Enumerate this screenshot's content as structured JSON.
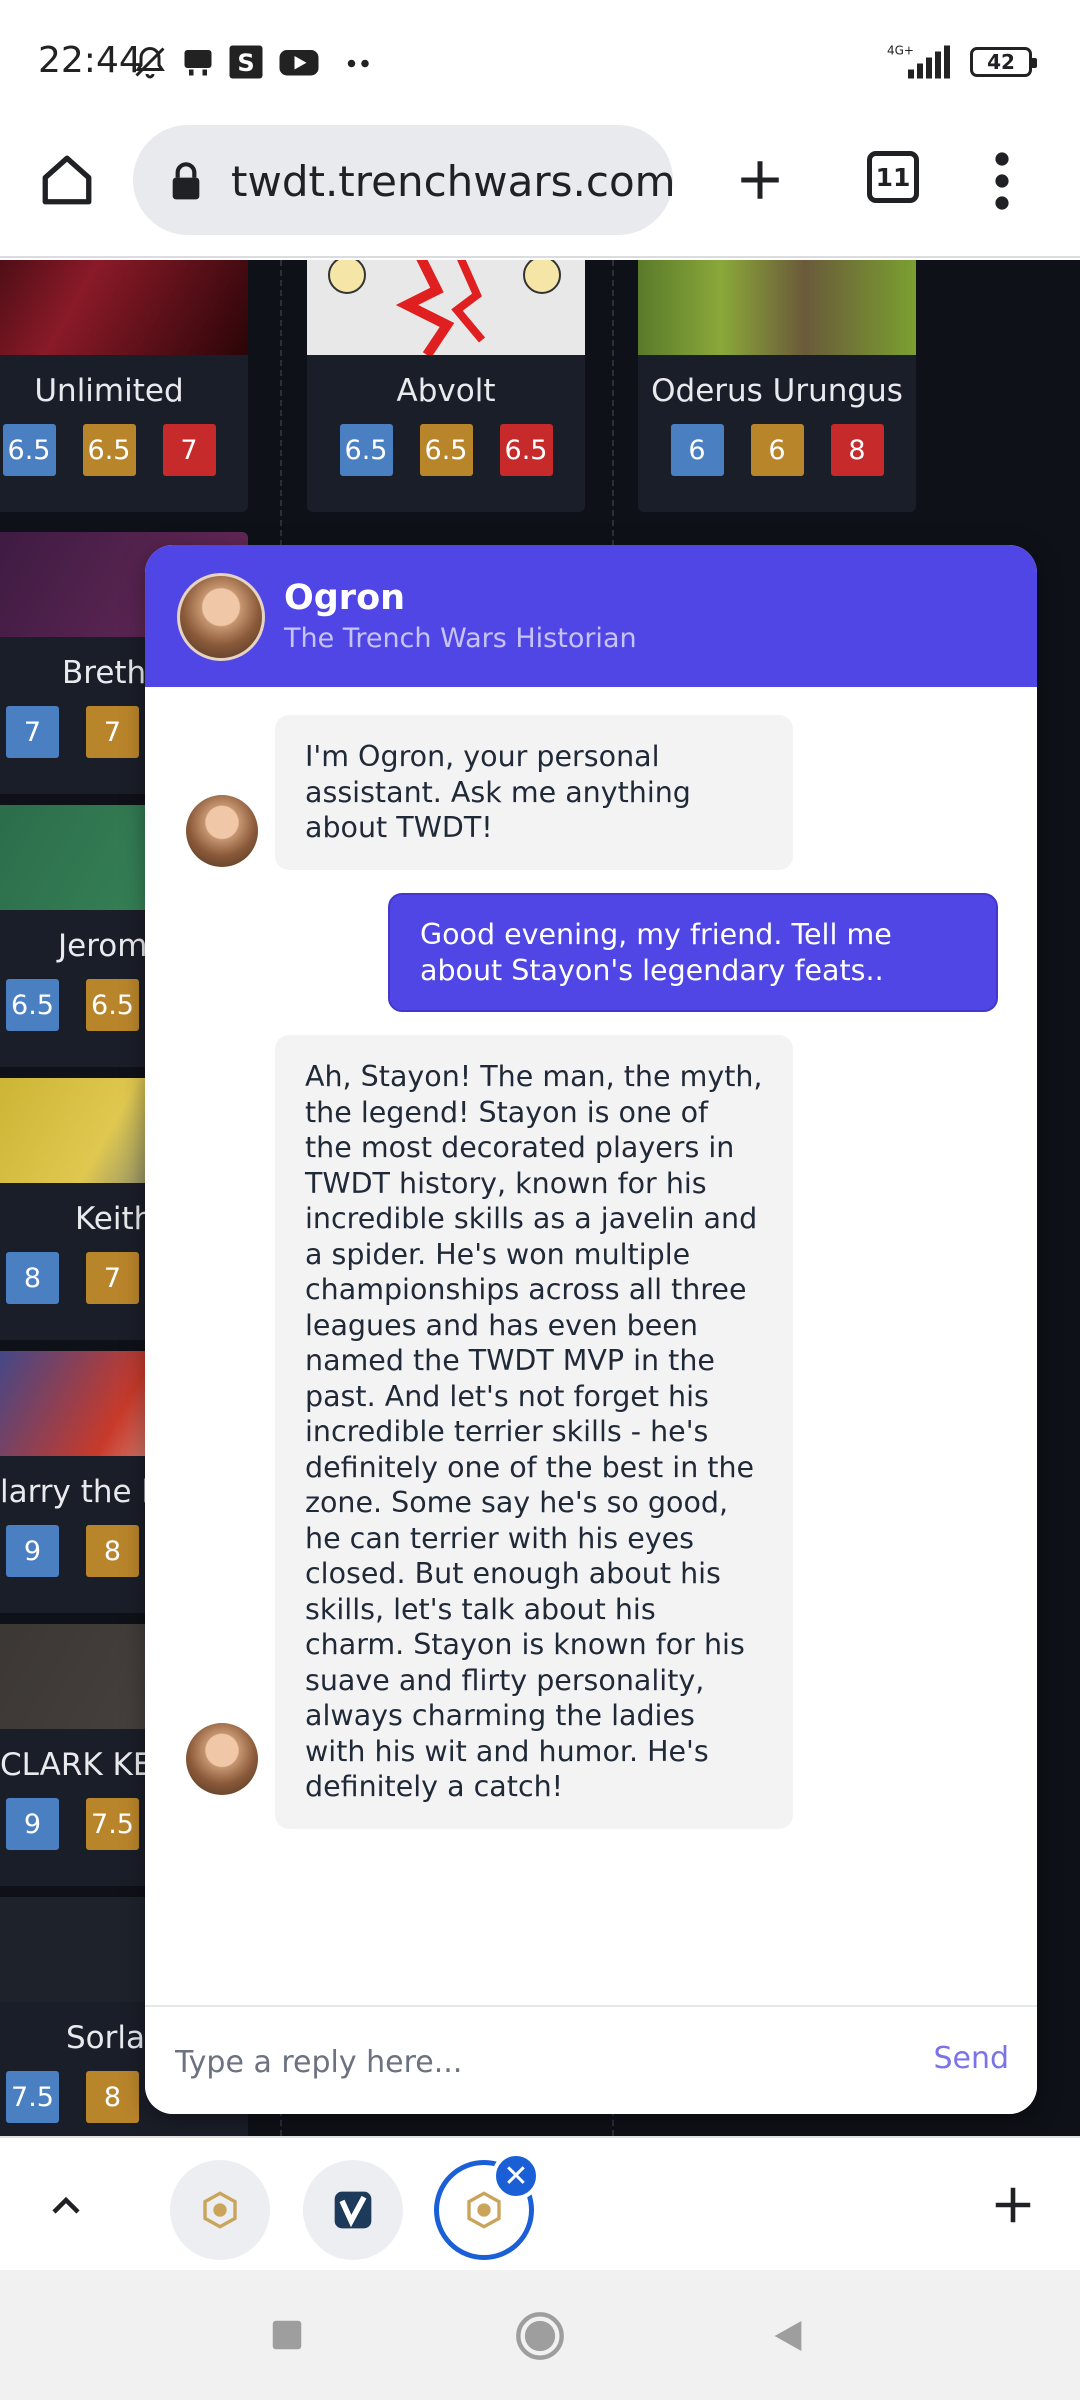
{
  "status_bar": {
    "time": "22:44",
    "network": "4G+",
    "battery": "42"
  },
  "browser": {
    "url": "twdt.trenchwars.com",
    "tab_count": "11"
  },
  "cards": [
    {
      "name": "Unlimited",
      "ratings": [
        "6.5",
        "6.5",
        "7"
      ]
    },
    {
      "name": "Abvolt",
      "ratings": [
        "6.5",
        "6.5",
        "6.5"
      ]
    },
    {
      "name": "Oderus Urungus",
      "ratings": [
        "6",
        "6",
        "8"
      ]
    },
    {
      "name": "Bretha",
      "ratings": [
        "7",
        "7"
      ]
    },
    {
      "name": "Jerom",
      "ratings": [
        "6.5",
        "6.5"
      ]
    },
    {
      "name": "Keith",
      "ratings": [
        "8",
        "7"
      ]
    },
    {
      "name": "larry the lo",
      "ratings": [
        "9",
        "8"
      ]
    },
    {
      "name": "CLARK KE",
      "ratings": [
        "9",
        "7.5"
      ]
    },
    {
      "name": "Sorla",
      "ratings": [
        "7.5",
        "8"
      ]
    }
  ],
  "chat": {
    "bot_name": "Ogron",
    "bot_subtitle": "The Trench Wars Historian",
    "messages": [
      {
        "from": "bot",
        "text": "I'm Ogron, your personal assistant. Ask me anything about TWDT!"
      },
      {
        "from": "user",
        "text": "Good evening, my friend. Tell me about Stayon's legendary feats.."
      },
      {
        "from": "bot",
        "text": "Ah, Stayon! The man, the myth, the legend! Stayon is one of the most decorated players in TWDT history, known for his incredible skills as a javelin and a spider. He's won multiple championships across all three leagues and has even been named the TWDT MVP in the past. And let's not forget his incredible terrier skills - he's definitely one of the best in the zone. Some say he's so good, he can terrier with his eyes closed. But enough about his skills, let's talk about his charm. Stayon is known for his suave and flirty personality, always charming the ladies with his wit and humor. He's definitely a catch!"
      }
    ],
    "input_placeholder": "Type a reply here...",
    "send_label": "Send"
  },
  "colors": {
    "accent": "#4f46e5",
    "page_bg": "#0e1117",
    "rating_blue": "#4a7fc1",
    "rating_gold": "#b9852b",
    "rating_red": "#c62a2a"
  }
}
